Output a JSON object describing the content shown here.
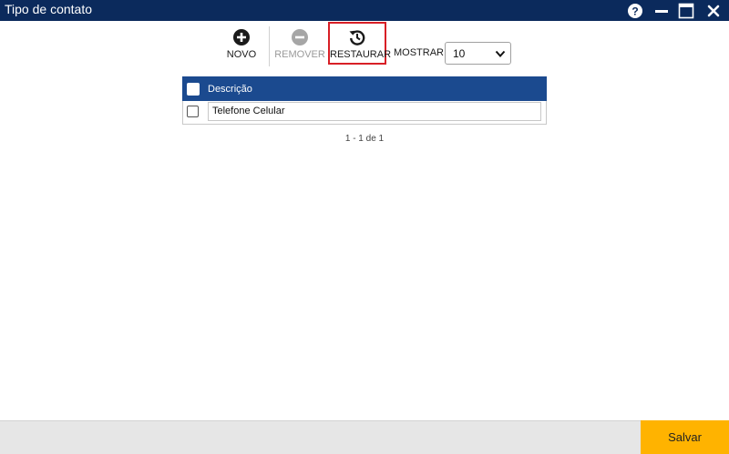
{
  "window": {
    "title": "Tipo de contato"
  },
  "title_controls": {
    "help_icon": "question-circle-icon",
    "minimize_icon": "minus-icon",
    "maximize_icon": "window-icon",
    "close_icon": "x-icon"
  },
  "toolbar": {
    "novo_label": "NOVO",
    "remover_label": "REMOVER",
    "restaurar_label": "RESTAURAR",
    "mostrar_label": "MOSTRAR:",
    "mostrar_value": "10"
  },
  "grid": {
    "header": "Descrição",
    "rows": [
      {
        "descricao": "Telefone Celular"
      }
    ]
  },
  "pager": {
    "text": "1 - 1 de 1"
  },
  "footer": {
    "save_label": "Salvar"
  },
  "colors": {
    "titlebar": "#0b2a5c",
    "grid_header": "#1b4a8f",
    "save_button": "#ffb300",
    "highlight_border": "#d81f26"
  }
}
